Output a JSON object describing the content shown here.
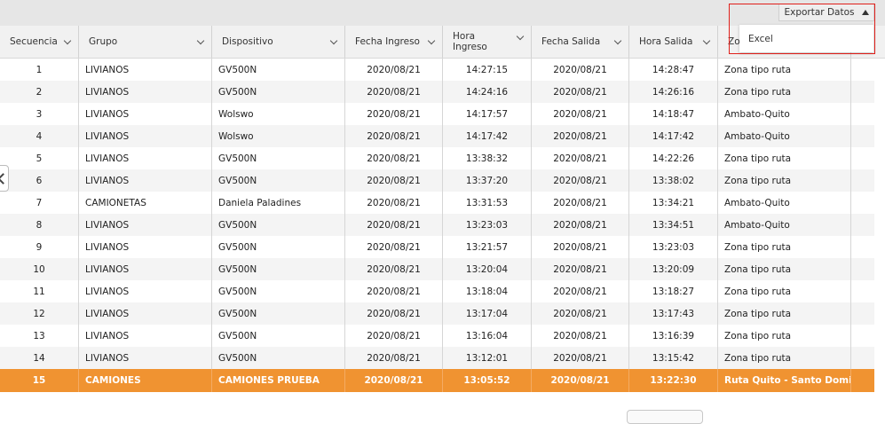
{
  "export": {
    "label": "Exportar Datos",
    "menu_item": "Excel"
  },
  "columns": [
    "Secuencia",
    "Grupo",
    "Dispositivo",
    "Fecha Ingreso",
    "Hora Ingreso",
    "Fecha Salida",
    "Hora Salida",
    "Zona"
  ],
  "rows": [
    [
      "1",
      "LIVIANOS",
      "GV500N",
      "2020/08/21",
      "14:27:15",
      "2020/08/21",
      "14:28:47",
      "Zona tipo ruta"
    ],
    [
      "2",
      "LIVIANOS",
      "GV500N",
      "2020/08/21",
      "14:24:16",
      "2020/08/21",
      "14:26:16",
      "Zona tipo ruta"
    ],
    [
      "3",
      "LIVIANOS",
      "Wolswo",
      "2020/08/21",
      "14:17:57",
      "2020/08/21",
      "14:18:47",
      "Ambato-Quito"
    ],
    [
      "4",
      "LIVIANOS",
      "Wolswo",
      "2020/08/21",
      "14:17:42",
      "2020/08/21",
      "14:17:42",
      "Ambato-Quito"
    ],
    [
      "5",
      "LIVIANOS",
      "GV500N",
      "2020/08/21",
      "13:38:32",
      "2020/08/21",
      "14:22:26",
      "Zona tipo ruta"
    ],
    [
      "6",
      "LIVIANOS",
      "GV500N",
      "2020/08/21",
      "13:37:20",
      "2020/08/21",
      "13:38:02",
      "Zona tipo ruta"
    ],
    [
      "7",
      "CAMIONETAS",
      "Daniela Paladines",
      "2020/08/21",
      "13:31:53",
      "2020/08/21",
      "13:34:21",
      "Ambato-Quito"
    ],
    [
      "8",
      "LIVIANOS",
      "GV500N",
      "2020/08/21",
      "13:23:03",
      "2020/08/21",
      "13:34:51",
      "Ambato-Quito"
    ],
    [
      "9",
      "LIVIANOS",
      "GV500N",
      "2020/08/21",
      "13:21:57",
      "2020/08/21",
      "13:23:03",
      "Zona tipo ruta"
    ],
    [
      "10",
      "LIVIANOS",
      "GV500N",
      "2020/08/21",
      "13:20:04",
      "2020/08/21",
      "13:20:09",
      "Zona tipo ruta"
    ],
    [
      "11",
      "LIVIANOS",
      "GV500N",
      "2020/08/21",
      "13:18:04",
      "2020/08/21",
      "13:18:27",
      "Zona tipo ruta"
    ],
    [
      "12",
      "LIVIANOS",
      "GV500N",
      "2020/08/21",
      "13:17:04",
      "2020/08/21",
      "13:17:43",
      "Zona tipo ruta"
    ],
    [
      "13",
      "LIVIANOS",
      "GV500N",
      "2020/08/21",
      "13:16:04",
      "2020/08/21",
      "13:16:39",
      "Zona tipo ruta"
    ],
    [
      "14",
      "LIVIANOS",
      "GV500N",
      "2020/08/21",
      "13:12:01",
      "2020/08/21",
      "13:15:42",
      "Zona tipo ruta"
    ],
    [
      "15",
      "CAMIONES",
      "CAMIONES PRUEBA",
      "2020/08/21",
      "13:05:52",
      "2020/08/21",
      "13:22:30",
      "Ruta Quito - Santo Domingo"
    ]
  ],
  "selected_row": 14,
  "colors": {
    "selected_row": "#f09331",
    "highlight_border": "#e0201b"
  },
  "icons": {
    "column_menu": "chevron-down-icon",
    "export_toggle": "caret-up-icon",
    "previous": "chevron-left-icon"
  }
}
